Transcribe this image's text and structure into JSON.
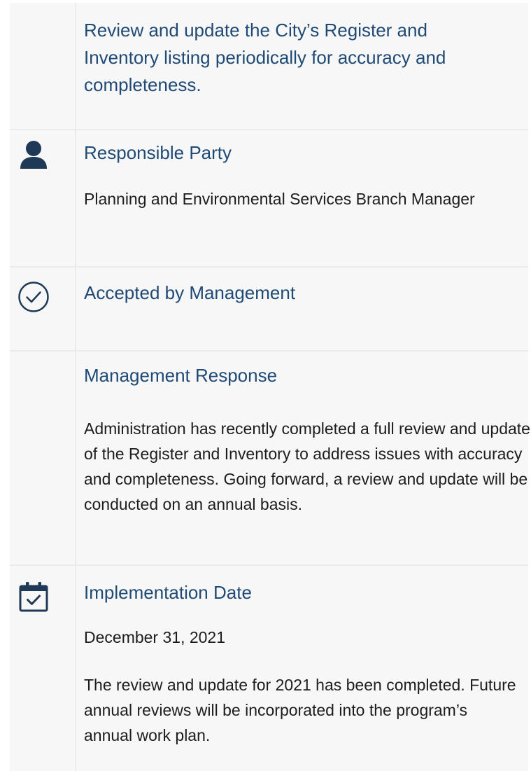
{
  "recommendation": {
    "text": "Review and update the City’s Register and Inventory listing periodically for accuracy and completeness."
  },
  "responsible_party": {
    "heading": "Responsible Party",
    "value": "Planning and Environmental Services Branch Manager",
    "icon": "person-icon"
  },
  "acceptance": {
    "heading": "Accepted by Management",
    "icon": "check-circle-icon"
  },
  "management_response": {
    "heading": "Management Response",
    "text": "Administration has recently completed a full review and update of the Register and Inventory to address issues with accuracy and completeness. Going forward, a review and update will be conducted on an annual basis."
  },
  "implementation": {
    "heading": "Implementation Date",
    "date": "December 31, 2021",
    "note": "The review and update for 2021 has been completed. Future annual reviews will be incorporated into the program’s annual work plan.",
    "icon": "calendar-check-icon"
  },
  "colors": {
    "heading": "#1f4a75",
    "icon": "#1f3a56",
    "panel": "#f7f7f7",
    "divider": "#ebebeb"
  }
}
